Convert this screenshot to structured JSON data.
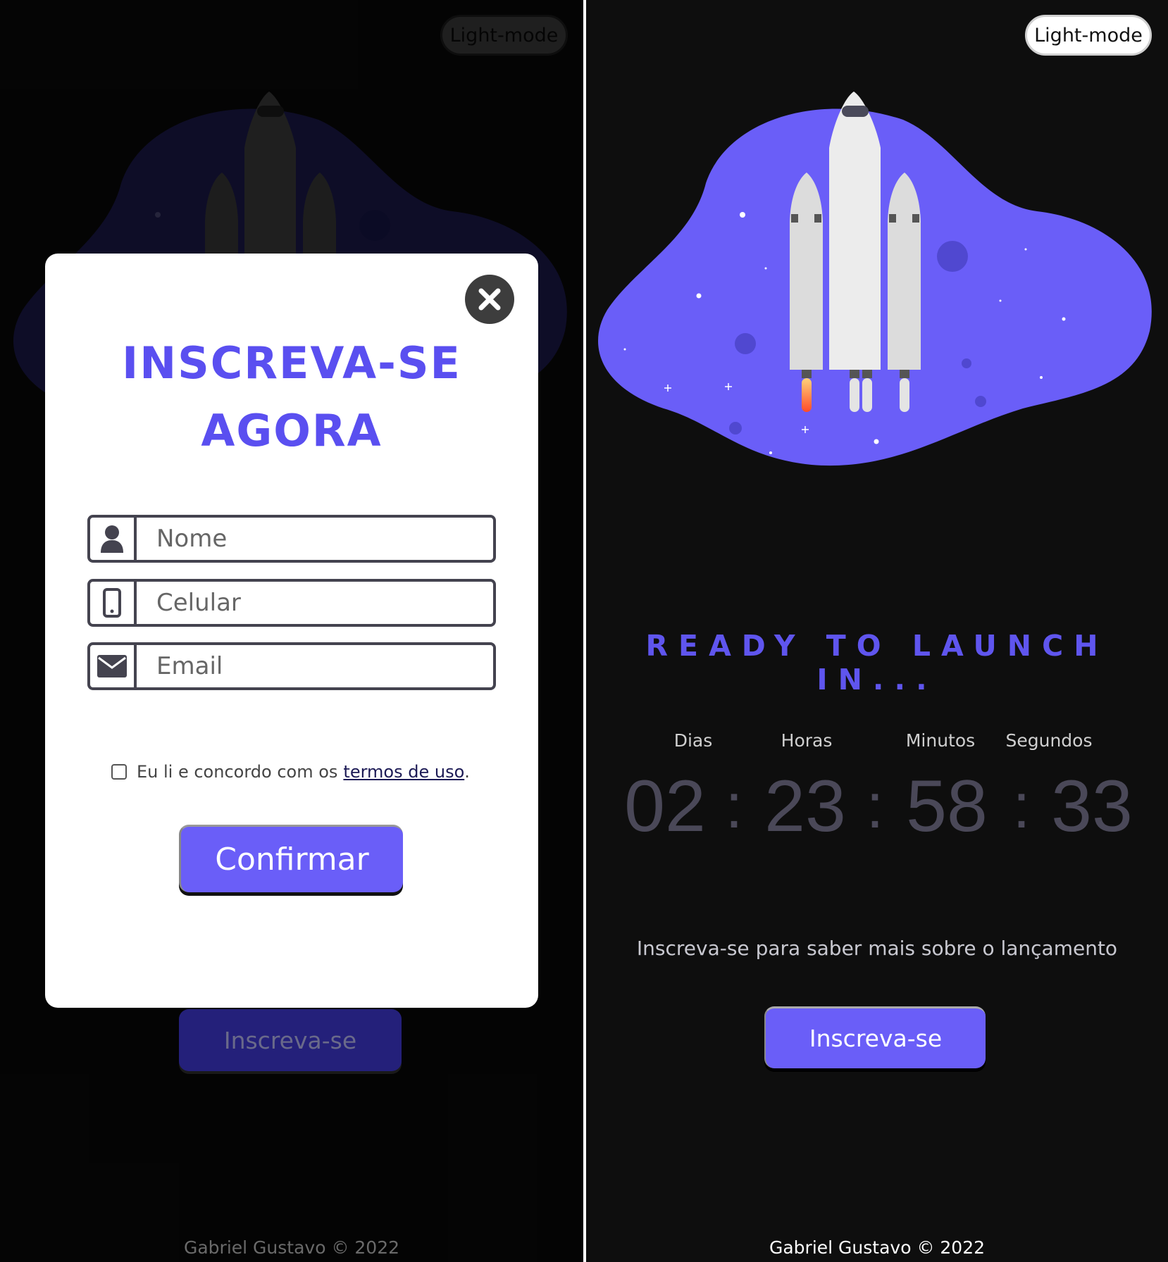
{
  "theme_toggle": {
    "label": "Light-mode"
  },
  "launch": {
    "headline": "READY TO LAUNCH IN...",
    "labels": [
      "Dias",
      "Horas",
      "Minutos",
      "Segundos"
    ],
    "days": "02",
    "hours": "23",
    "minutes": "58",
    "seconds": "33",
    "separator": ":",
    "subtext": "Inscreva-se para saber mais sobre o lançamento",
    "cta_label": "Inscreva-se"
  },
  "modal": {
    "title_line1": "INSCREVA-SE",
    "title_line2": "AGORA",
    "fields": [
      {
        "placeholder": "Nome",
        "icon": "user-icon"
      },
      {
        "placeholder": "Celular",
        "icon": "phone-icon"
      },
      {
        "placeholder": "Email",
        "icon": "envelope-icon"
      }
    ],
    "terms_text": "Eu li e concordo com os",
    "terms_link": "termos de uso",
    "terms_period": ".",
    "confirm_label": "Confirmar",
    "close_icon": "close-icon"
  },
  "footer": {
    "text": "Gabriel Gustavo © 2022"
  },
  "colors": {
    "accent": "#6a5ef8",
    "headline": "#5f55ee",
    "background": "#0e0e0e",
    "blob": "#6a5ef8"
  }
}
